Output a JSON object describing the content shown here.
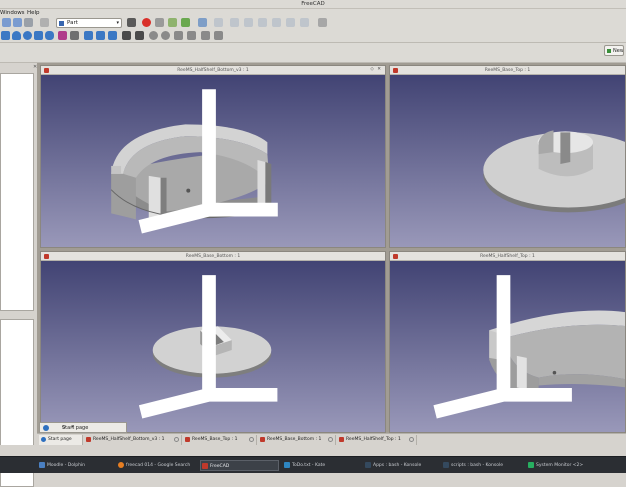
{
  "window": {
    "title": "FreeCAD"
  },
  "menu": {
    "windows": "Windows",
    "help": "Help"
  },
  "workbench": {
    "selected": "Part"
  },
  "band_button": "New",
  "viewports": [
    {
      "title": "ReeMS_HalfShelf_Bottom_v3 : 1"
    },
    {
      "title": "ReeMS_Base_Top : 1"
    },
    {
      "title": "ReeMS_Base_Bottom : 1"
    },
    {
      "title": "ReeMS_HalfShelf_Top : 1"
    }
  ],
  "start_page": {
    "label": "Start page"
  },
  "tabs": [
    {
      "label": "Start page"
    },
    {
      "label": "ReeMS_HalfShelf_Bottom_v3 : 1"
    },
    {
      "label": "ReeMS_Base_Top : 1"
    },
    {
      "label": "ReeMS_Base_Bottom : 1"
    },
    {
      "label": "ReeMS_HalfShelf_Top : 1"
    }
  ],
  "taskbar": [
    {
      "label": "Moodle - Dolphin",
      "color": "#4a7fc1"
    },
    {
      "label": "freecad 014 - Google Search",
      "color": "#e67e22"
    },
    {
      "label": "FreeCAD",
      "color": "#c0392b"
    },
    {
      "label": "ToDo.txt - Kate",
      "color": "#2e86c1"
    },
    {
      "label": "Apps : bash - Konsole",
      "color": "#34495e"
    },
    {
      "label": "scripts : bash - Konsole",
      "color": "#34495e"
    },
    {
      "label": "System Monitor <2>",
      "color": "#27ae60"
    }
  ],
  "colors": {
    "viewport_top": "#3d3f70",
    "viewport_bottom": "#9998b9",
    "part_fill": "#c8c8c8"
  }
}
